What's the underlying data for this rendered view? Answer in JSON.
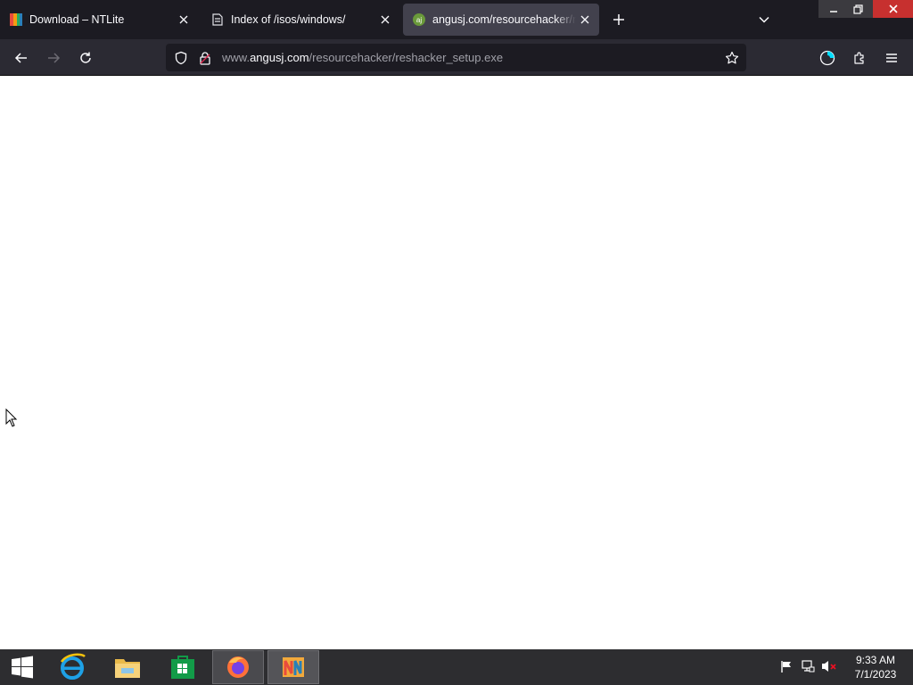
{
  "browser": {
    "tabs": [
      {
        "title": "Download – NTLite",
        "favicon": "ntlite-icon"
      },
      {
        "title": "Index of /isos/windows/",
        "favicon": "directory-icon"
      },
      {
        "title": "angusj.com/resourcehacker/reshacker_setup.exe",
        "favicon": "angusj-icon",
        "active": true
      }
    ],
    "url": {
      "prefix": "www.",
      "host": "angusj.com",
      "path": "/resourcehacker/reshacker_setup.exe"
    }
  },
  "taskbar": {
    "apps": [
      "start-button",
      "internet-explorer-icon",
      "file-explorer-icon",
      "store-icon",
      "firefox-icon",
      "ntlite-icon"
    ],
    "clock": {
      "time": "9:33 AM",
      "date": "7/1/2023"
    }
  },
  "colors": {
    "tab_strip": "#1c1b22",
    "nav_bar": "#2b2a33",
    "active_tab": "#42414d",
    "taskbar": "#2d2d30",
    "close_button": "#c7302f"
  }
}
